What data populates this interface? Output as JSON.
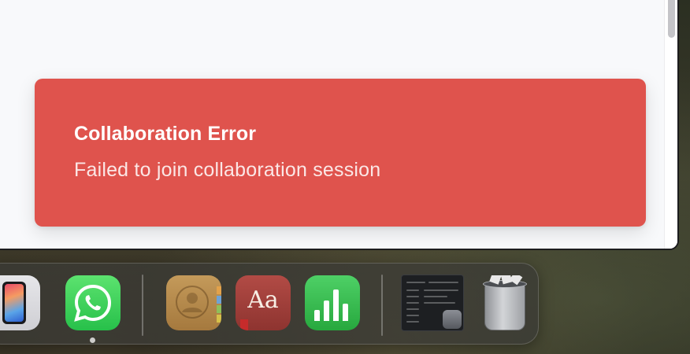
{
  "toast": {
    "title": "Collaboration Error",
    "message": "Failed to join collaboration session",
    "background_color": "#df534d"
  },
  "dock": {
    "apps": [
      {
        "name": "iPhone Mirroring",
        "icon": "iphone-icon",
        "running": false
      },
      {
        "name": "WhatsApp",
        "icon": "whatsapp-icon",
        "running": true
      },
      {
        "name": "Contacts",
        "icon": "contacts-icon",
        "running": false
      },
      {
        "name": "Dictionary",
        "icon": "dictionary-icon",
        "running": false,
        "glyph": "Aa"
      },
      {
        "name": "Numbers",
        "icon": "numbers-icon",
        "running": false
      },
      {
        "name": "System Settings window",
        "icon": "window-preview-icon",
        "running": false
      },
      {
        "name": "Trash",
        "icon": "trash-icon",
        "running": false
      }
    ]
  }
}
